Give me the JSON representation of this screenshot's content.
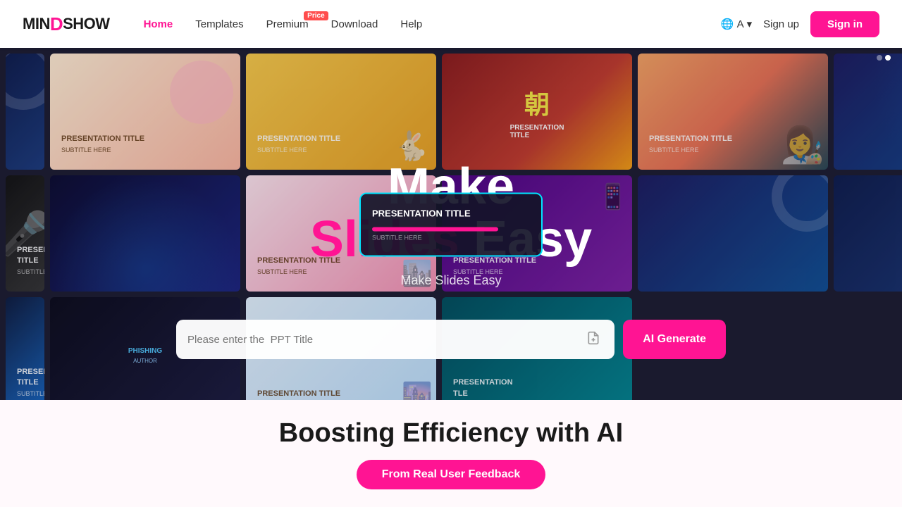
{
  "nav": {
    "logo": "MINDSHOW",
    "logo_mind": "MIND",
    "logo_d": "D",
    "logo_show": "SHOW",
    "links": [
      {
        "id": "home",
        "label": "Home",
        "active": true
      },
      {
        "id": "templates",
        "label": "Templates",
        "active": false
      },
      {
        "id": "premium",
        "label": "Premium",
        "active": false,
        "badge": "Price"
      },
      {
        "id": "download",
        "label": "Download",
        "active": false
      },
      {
        "id": "help",
        "label": "Help",
        "active": false
      }
    ],
    "lang_icon": "A",
    "signup_label": "Sign up",
    "signin_label": "Sign in"
  },
  "hero": {
    "make_label": "Make",
    "slides_label": "Slides",
    "easy_label": "Easy",
    "subtitle": "Make Slides Easy",
    "scroll_dots": [
      false,
      true
    ]
  },
  "center_popup": {
    "title": "PRESENTATION TITLE",
    "subtitle": "SUBTITLE HERE"
  },
  "search": {
    "placeholder": "Please enter the  PPT Title",
    "ai_generate_label": "AI Generate"
  },
  "bottom": {
    "boosting_title": "Boosting Efficiency with AI",
    "feedback_label": "From Real User Feedback"
  },
  "slides": [
    {
      "id": "s1",
      "theme": "dark-blue",
      "title": "PRESENTATION TITLE",
      "subtitle": "SUBTITLE HERE"
    },
    {
      "id": "s2",
      "theme": "pink-animal",
      "title": "PRESENTATION TITLE",
      "subtitle": "SUBTITLE HERE"
    },
    {
      "id": "s3",
      "theme": "yellow-rabbit",
      "title": "PRESENTATION TITLE",
      "subtitle": "SUBTITLE HERE"
    },
    {
      "id": "s4",
      "theme": "chinese-style",
      "title": "PRESENTATION TITLE",
      "subtitle": ""
    },
    {
      "id": "s5",
      "theme": "anime-girl",
      "title": "PRESENTATION TITLE",
      "subtitle": "SUBTITLE HERE"
    },
    {
      "id": "s6",
      "theme": "abstract-blue",
      "title": "",
      "subtitle": ""
    },
    {
      "id": "s7",
      "theme": "reporter",
      "title": "SUBTITLE HERE",
      "subtitle": ""
    },
    {
      "id": "s8",
      "theme": "dark-mic",
      "title": "PRESENTATION TITLE",
      "subtitle": "SUBTITLE HERE"
    },
    {
      "id": "s9",
      "theme": "space-blue",
      "title": "PRESENTATION TITLE",
      "subtitle": "SUBTITLE HERE"
    },
    {
      "id": "s10",
      "theme": "pink-city",
      "title": "PRESENTATION TITLE",
      "subtitle": "SUBTITLE HERE"
    },
    {
      "id": "s11",
      "theme": "purple-abstract",
      "title": "PRESENTATION TITLE",
      "subtitle": "SUBTITLE HERE"
    },
    {
      "id": "s12",
      "theme": "dark-blue2",
      "title": "PRESENTATION TITLE",
      "subtitle": "SUBTITLE HERE"
    },
    {
      "id": "s13",
      "theme": "space-dark",
      "title": "PHISHING",
      "subtitle": "AUTHOR"
    },
    {
      "id": "s14",
      "theme": "pastel-city",
      "title": "PRESENTATION TITLE",
      "subtitle": ""
    },
    {
      "id": "s15",
      "theme": "teal-wave",
      "title": "PRESENTATION",
      "subtitle": "Tle"
    }
  ]
}
